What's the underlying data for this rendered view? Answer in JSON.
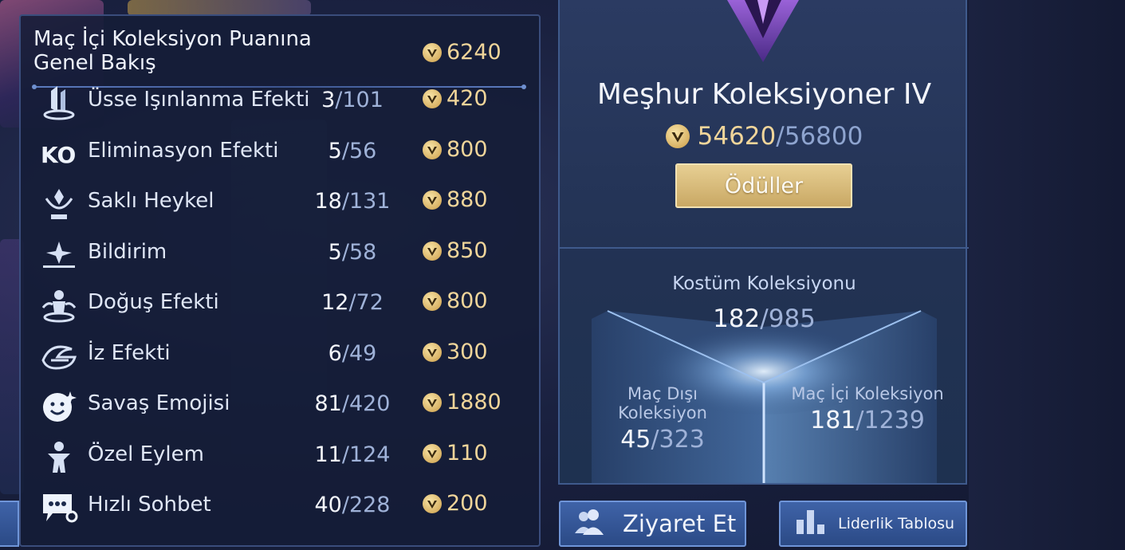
{
  "collection_panel": {
    "title": "Maç İçi Koleksiyon Puanına Genel Bakış",
    "total_points": "6240",
    "rows": [
      {
        "icon": "teleport-effect-icon",
        "label": "Üsse Işınlanma Efekti",
        "have": "3",
        "max": "101",
        "points": "420"
      },
      {
        "icon": "ko-elimination-icon",
        "label": "Eliminasyon Efekti",
        "have": "5",
        "max": "56",
        "points": "800"
      },
      {
        "icon": "hidden-statue-icon",
        "label": "Saklı Heykel",
        "have": "18",
        "max": "131",
        "points": "880"
      },
      {
        "icon": "notification-icon",
        "label": "Bildirim",
        "have": "5",
        "max": "58",
        "points": "850"
      },
      {
        "icon": "spawn-effect-icon",
        "label": "Doğuş Efekti",
        "have": "12",
        "max": "72",
        "points": "800"
      },
      {
        "icon": "trail-effect-icon",
        "label": "İz Efekti",
        "have": "6",
        "max": "49",
        "points": "300"
      },
      {
        "icon": "battle-emote-icon",
        "label": "Savaş Emojisi",
        "have": "81",
        "max": "420",
        "points": "1880"
      },
      {
        "icon": "special-action-icon",
        "label": "Özel Eylem",
        "have": "11",
        "max": "124",
        "points": "110"
      },
      {
        "icon": "quick-chat-icon",
        "label": "Hızlı Sohbet",
        "have": "40",
        "max": "228",
        "points": "200"
      }
    ]
  },
  "rank": {
    "title": "Meşhur Koleksiyoner IV",
    "current": "54620",
    "separator": "/",
    "max": "56800",
    "rewards_label": "Ödüller"
  },
  "costume": {
    "title": "Kostüm Koleksiyonu",
    "have": "182",
    "max": "985"
  },
  "sub_collections": {
    "outside": {
      "title": "Maç Dışı Koleksiyon",
      "have": "45",
      "max": "323"
    },
    "inside": {
      "title": "Maç İçi Koleksiyon",
      "have": "181",
      "max": "1239"
    }
  },
  "buttons": {
    "visit": "Ziyaret Et",
    "leaderboard": "Liderlik Tablosu"
  },
  "colors": {
    "gold": "#f0d59a",
    "panel": "#141d37",
    "accent_blue": "#3f63a8"
  }
}
